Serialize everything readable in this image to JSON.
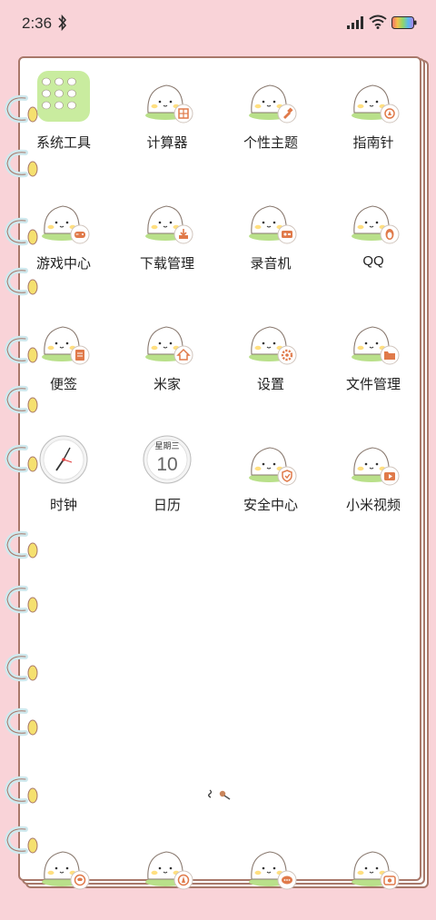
{
  "status_bar": {
    "time": "2:36",
    "bluetooth_icon": "bluetooth-icon",
    "signal_icon": "signal-icon",
    "wifi_icon": "wifi-icon",
    "battery_icon": "battery-icon"
  },
  "apps": [
    {
      "label": "系统工具",
      "icon": "folder-icon"
    },
    {
      "label": "计算器",
      "icon": "calculator-icon"
    },
    {
      "label": "个性主题",
      "icon": "theme-brush-icon"
    },
    {
      "label": "指南针",
      "icon": "compass-icon"
    },
    {
      "label": "游戏中心",
      "icon": "gamepad-icon"
    },
    {
      "label": "下载管理",
      "icon": "download-icon"
    },
    {
      "label": "录音机",
      "icon": "recorder-icon"
    },
    {
      "label": "QQ",
      "icon": "penguin-icon"
    },
    {
      "label": "便签",
      "icon": "note-icon"
    },
    {
      "label": "米家",
      "icon": "home-icon"
    },
    {
      "label": "设置",
      "icon": "gear-icon"
    },
    {
      "label": "文件管理",
      "icon": "folder-icon"
    },
    {
      "label": "时钟",
      "icon": "clock-icon"
    },
    {
      "label": "日历",
      "icon": "calendar-icon"
    },
    {
      "label": "安全中心",
      "icon": "shield-icon"
    },
    {
      "label": "小米视频",
      "icon": "video-icon"
    }
  ],
  "calendar_widget": {
    "weekday": "星期三",
    "day": "10"
  },
  "dock": [
    {
      "icon": "phone-icon"
    },
    {
      "icon": "compass-browser-icon"
    },
    {
      "icon": "message-icon"
    },
    {
      "icon": "camera-icon"
    }
  ],
  "colors": {
    "background": "#f9d3d8",
    "paper_border": "#a8786a",
    "badge": "#e07a4a",
    "grass": "#b9e08a"
  }
}
